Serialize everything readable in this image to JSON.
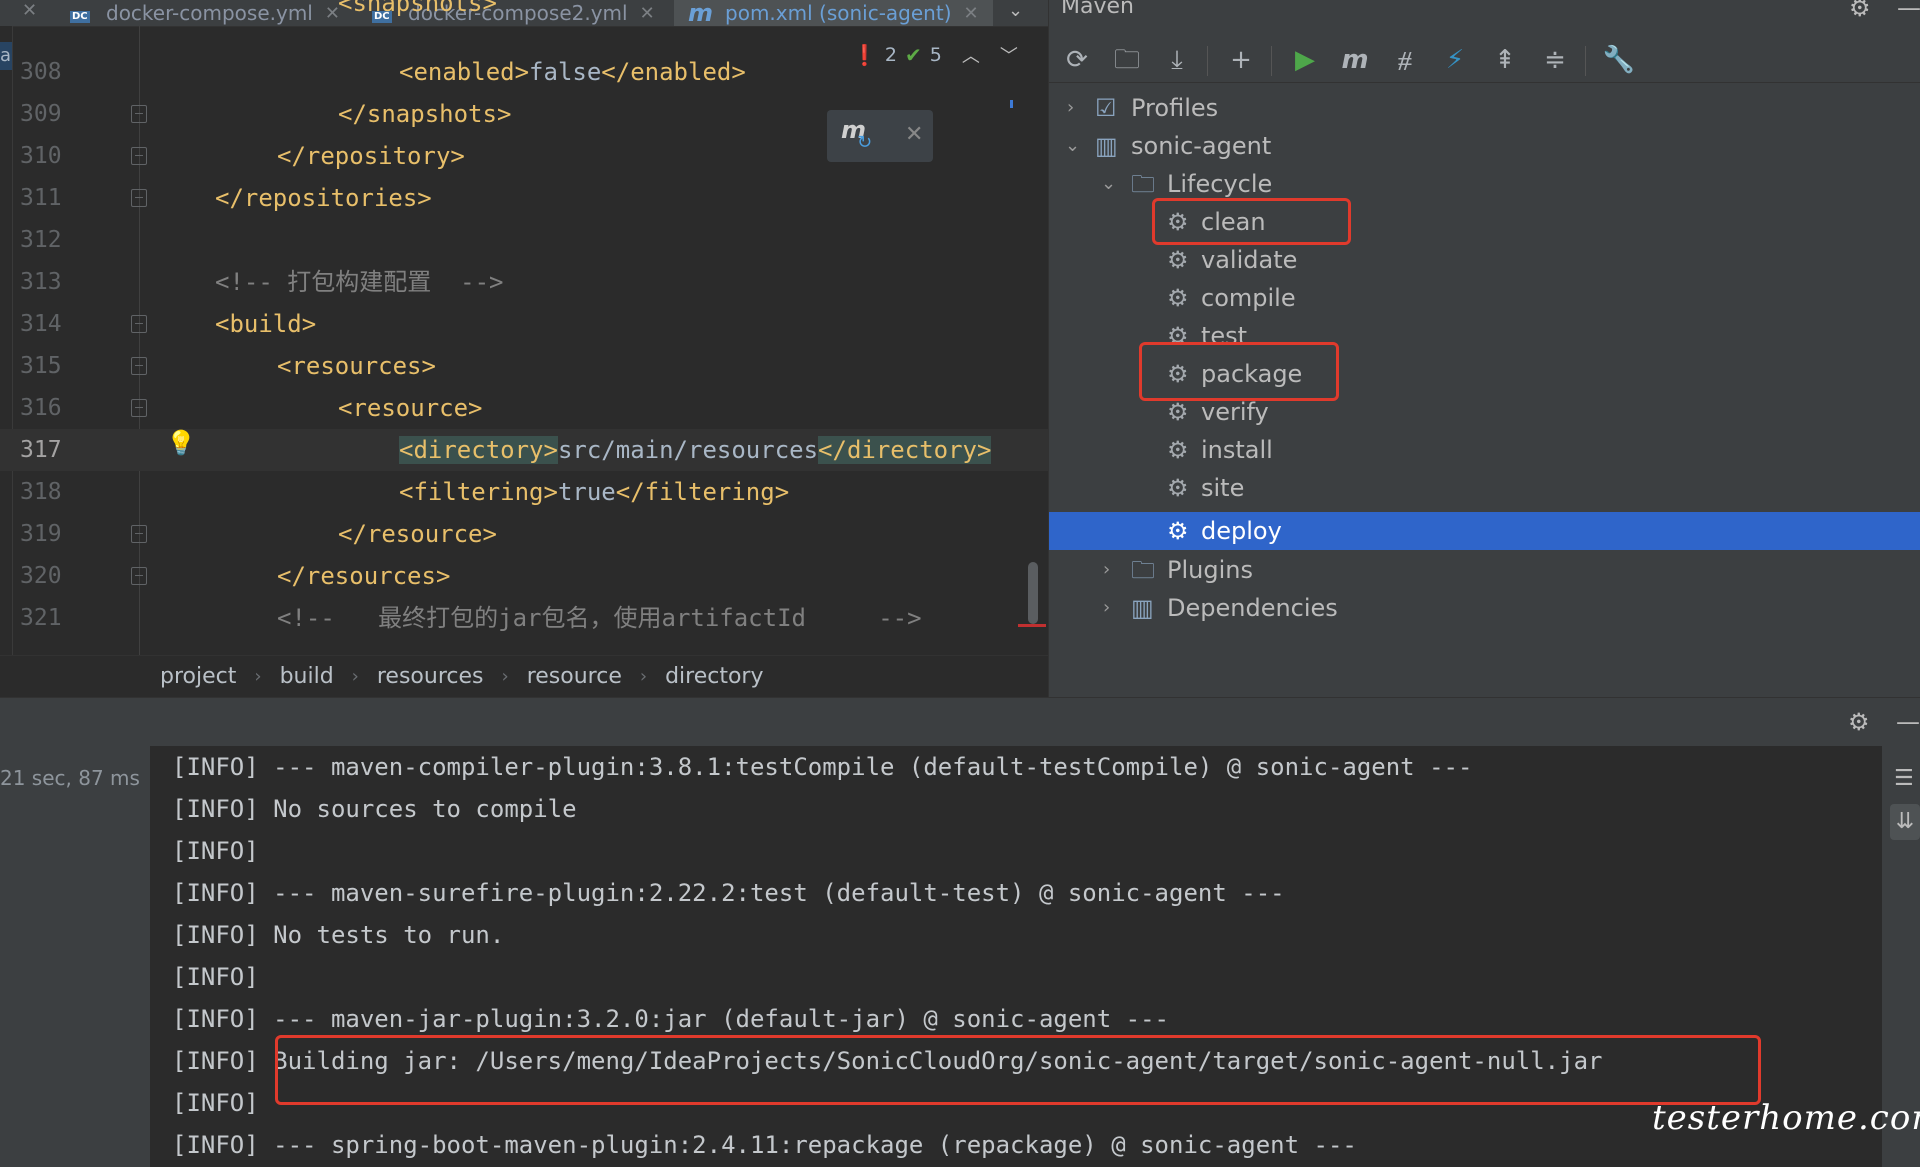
{
  "editor": {
    "tabs": [
      {
        "label": "docker-compose.yml",
        "icon": "docker-compose-file-icon"
      },
      {
        "label": "docker-compose2.yml",
        "icon": "docker-compose-file-icon"
      },
      {
        "label": "pom.xml (sonic-agent)",
        "icon": "maven-file-icon",
        "active": true
      }
    ],
    "gutter_marker": "a",
    "inspections": {
      "errors": "2",
      "warnings_ok": "5"
    },
    "lines": [
      {
        "num": "308",
        "code": "<enabled>false</enabled>"
      },
      {
        "num": "309",
        "code": "</snapshots>"
      },
      {
        "num": "310",
        "code": "</repository>"
      },
      {
        "num": "311",
        "code": "</repositories>"
      },
      {
        "num": "312",
        "code": ""
      },
      {
        "num": "313",
        "code": "<!-- 打包构建配置  -->"
      },
      {
        "num": "314",
        "code": "<build>"
      },
      {
        "num": "315",
        "code": "<resources>"
      },
      {
        "num": "316",
        "code": "<resource>"
      },
      {
        "num": "317",
        "code_parts": [
          "<directory>",
          "src/main/resources",
          "</directory>"
        ]
      },
      {
        "num": "318",
        "code_parts": [
          "<filtering>",
          "true",
          "</filtering>"
        ]
      },
      {
        "num": "319",
        "code": "</resource>"
      },
      {
        "num": "320",
        "code": "</resources>"
      },
      {
        "num": "321",
        "code": "<!--   最终打包的jar包名，使用artifactId     -->"
      }
    ],
    "line_308_parts": [
      "<enabled>",
      "false",
      "</enabled>"
    ],
    "breadcrumb": [
      "project",
      "build",
      "resources",
      "resource",
      "directory"
    ]
  },
  "maven": {
    "title": "Maven",
    "tree": {
      "profiles": "Profiles",
      "project": "sonic-agent",
      "lifecycle": "Lifecycle",
      "phases": [
        "clean",
        "validate",
        "compile",
        "test",
        "package",
        "verify",
        "install",
        "site",
        "deploy"
      ],
      "selected_phase": "deploy",
      "highlighted_phases": [
        "clean",
        "package"
      ],
      "plugins": "Plugins",
      "dependencies": "Dependencies"
    },
    "highlight_color": "#e03a2c",
    "selection_color": "#2f65ca"
  },
  "run": {
    "elapsed": "21 sec, 87 ms",
    "console": [
      "[INFO] --- maven-compiler-plugin:3.8.1:testCompile (default-testCompile) @ sonic-agent ---",
      "[INFO] No sources to compile",
      "[INFO]",
      "[INFO] --- maven-surefire-plugin:2.22.2:test (default-test) @ sonic-agent ---",
      "[INFO] No tests to run.",
      "[INFO]",
      "[INFO] --- maven-jar-plugin:3.2.0:jar (default-jar) @ sonic-agent ---",
      "[INFO] Building jar: /Users/meng/IdeaProjects/SonicCloudOrg/sonic-agent/target/sonic-agent-null.jar",
      "[INFO]",
      "[INFO] --- spring-boot-maven-plugin:2.4.11:repackage (repackage) @ sonic-agent ---"
    ]
  },
  "watermark": "testerhome.com"
}
